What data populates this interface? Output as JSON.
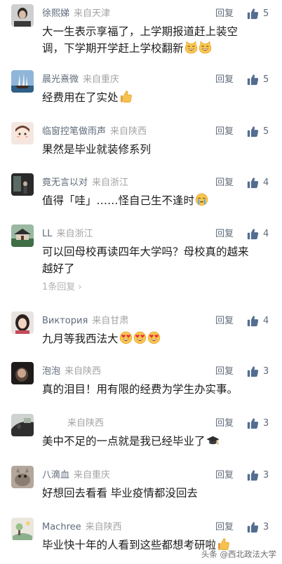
{
  "reply_label": "回复",
  "watermark": "头条 @西北政法大学",
  "comments": [
    {
      "name": "徐熙娣",
      "location": "来自天津",
      "likes": "5",
      "text": "大一生表示享福了，上学期报道赶上装空调，下学期开学赶上学校翻新",
      "emoji": "cat-smile"
    },
    {
      "name": "晨光熹微",
      "location": "来自重庆",
      "likes": "5",
      "text": "经费用在了实处",
      "emoji": "thumbs-up"
    },
    {
      "name": "临窗控笔做雨声",
      "location": "来自陕西",
      "likes": "5",
      "text": "果然是毕业就装修系列",
      "emoji": ""
    },
    {
      "name": "竟无言以对",
      "location": "来自浙江",
      "likes": "4",
      "text": "值得「哇」……怪自己生不逢时",
      "emoji": "crying-face"
    },
    {
      "name": "LL",
      "location": "来自浙江",
      "likes": "4",
      "text": "可以回母校再读四年大学吗？母校真的越来越好了",
      "emoji": "",
      "sub_replies": "1条回复"
    },
    {
      "name": "Виктория",
      "location": "来自甘肃",
      "likes": "4",
      "text": "九月等我西法大",
      "emoji": "heart-eyes"
    },
    {
      "name": "泡泡",
      "location": "来自陕西",
      "likes": "3",
      "text": "真的泪目！用有限的经费为学生办实事。",
      "emoji": ""
    },
    {
      "name": "",
      "location": "来自陕西",
      "likes": "3",
      "text": "美中不足的一点就是我已经毕业了",
      "emoji": "graduation-cap"
    },
    {
      "name": "八滴血",
      "location": "来自重庆",
      "likes": "3",
      "text": "好想回去看看 毕业疫情都没回去",
      "emoji": ""
    },
    {
      "name": "Machree",
      "location": "来自陕西",
      "likes": "3",
      "text": "毕业快十年的人看到这些都想考研啦",
      "emoji": "thumbs-up"
    }
  ]
}
